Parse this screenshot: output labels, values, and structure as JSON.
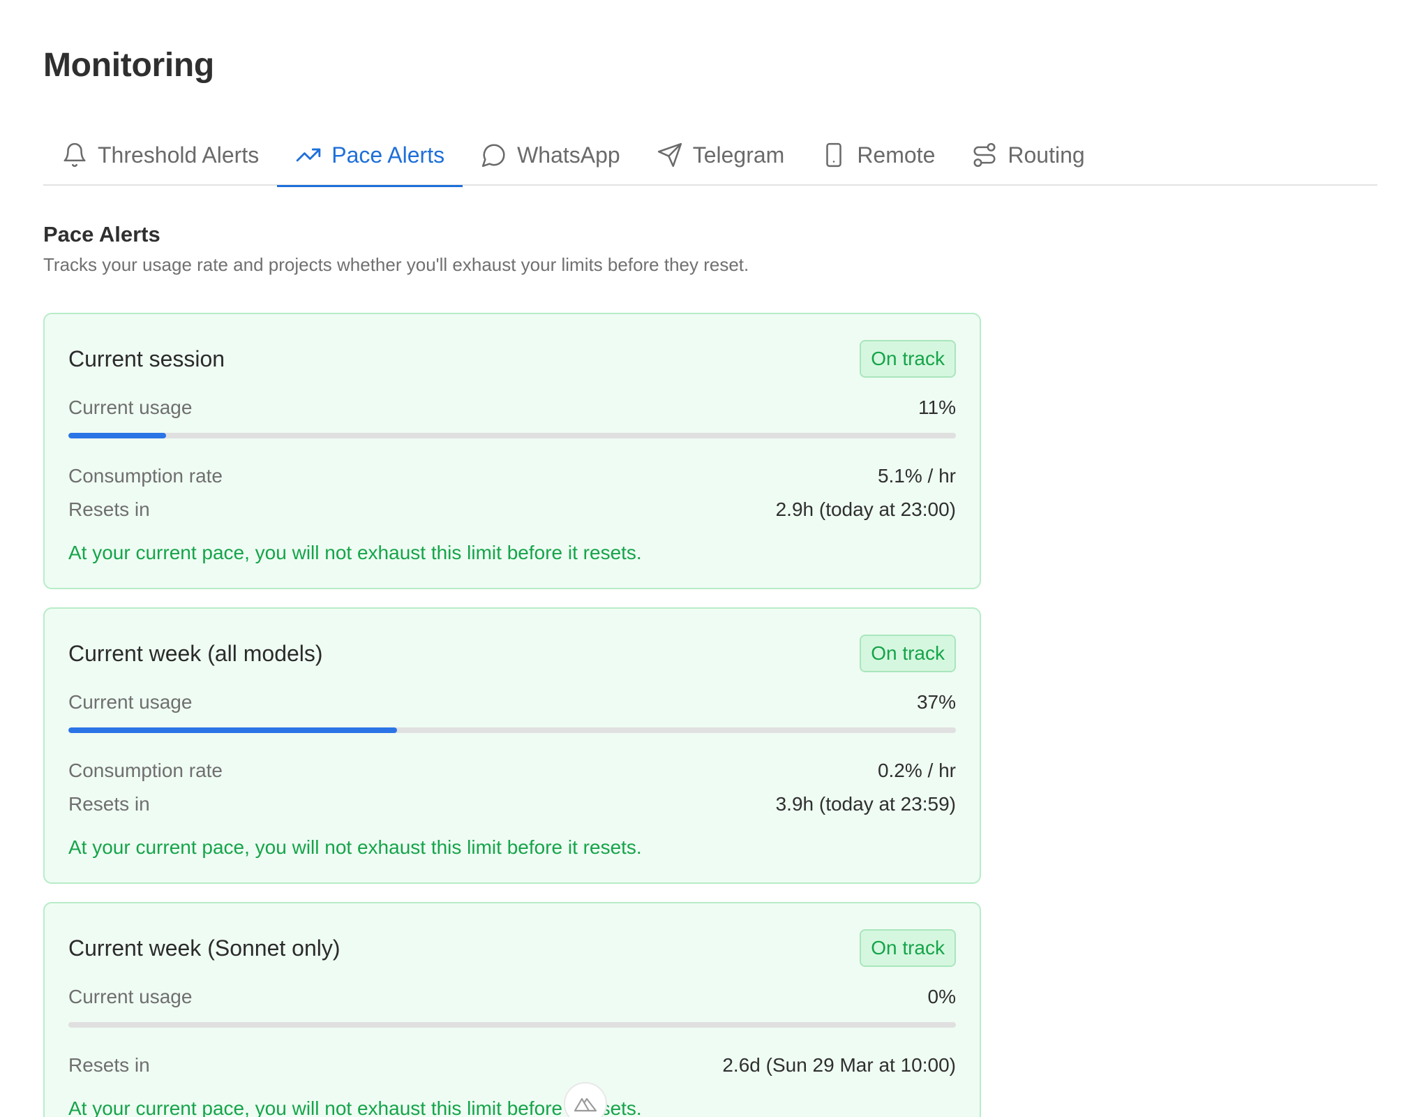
{
  "page": {
    "title": "Monitoring"
  },
  "tabs": [
    {
      "label": "Threshold Alerts",
      "icon": "bell-icon",
      "active": false
    },
    {
      "label": "Pace Alerts",
      "icon": "trending-up-icon",
      "active": true
    },
    {
      "label": "WhatsApp",
      "icon": "chat-bubble-icon",
      "active": false
    },
    {
      "label": "Telegram",
      "icon": "paper-plane-icon",
      "active": false
    },
    {
      "label": "Remote",
      "icon": "phone-icon",
      "active": false
    },
    {
      "label": "Routing",
      "icon": "routing-icon",
      "active": false
    }
  ],
  "section": {
    "heading": "Pace Alerts",
    "description": "Tracks your usage rate and projects whether you'll exhaust your limits before they reset."
  },
  "labels": {
    "usage": "Current usage",
    "rate": "Consumption rate",
    "resets": "Resets in"
  },
  "cards": [
    {
      "title": "Current session",
      "status": "On track",
      "usage": "11%",
      "usage_fraction": 0.11,
      "rate": "5.1% / hr",
      "resets": "2.9h (today at 23:00)",
      "message": "At your current pace, you will not exhaust this limit before it resets."
    },
    {
      "title": "Current week (all models)",
      "status": "On track",
      "usage": "37%",
      "usage_fraction": 0.37,
      "rate": "0.2% / hr",
      "resets": "3.9h (today at 23:59)",
      "message": "At your current pace, you will not exhaust this limit before it resets."
    },
    {
      "title": "Current week (Sonnet only)",
      "status": "On track",
      "usage": "0%",
      "usage_fraction": 0,
      "resets": "2.6d (Sun 29 Mar at 10:00)",
      "message": "At your current pace, you will not exhaust this limit before it resets."
    }
  ],
  "colors": {
    "accent": "#1e6fd9",
    "bar_fill": "#2a74e6",
    "success": "#15a44a",
    "card_bg": "#effcf3",
    "card_border": "#b7ecc8"
  },
  "floating_button": {
    "icon": "nuxt-logo-icon"
  }
}
